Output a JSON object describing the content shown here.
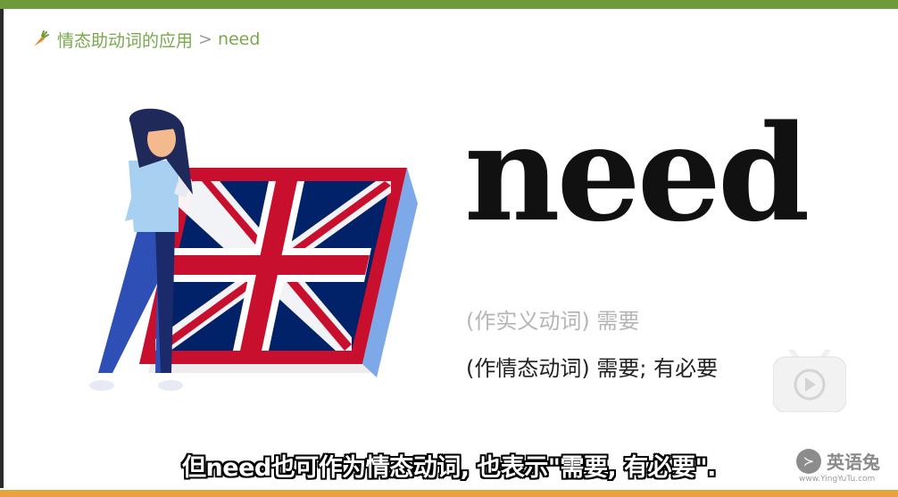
{
  "breadcrumb": {
    "icon": "carrot-icon",
    "section": "情态助动词的应用",
    "separator": ">",
    "current": "need"
  },
  "word": "need",
  "meanings": {
    "lexical": "(作实义动词) 需要",
    "modal": "(作情态动词) 需要; 有必要"
  },
  "subtitle": "但need也可作为情态动词, 也表示\"需要, 有必要\".",
  "watermark": {
    "brand": "英语兔",
    "url": "www.YingYuTu.com"
  },
  "colors": {
    "top_bar": "#6f9a3c",
    "bottom_bar": "#e8a33a",
    "breadcrumb_text": "#7aa84c",
    "flag_red": "#c8102e",
    "flag_blue": "#012169"
  }
}
